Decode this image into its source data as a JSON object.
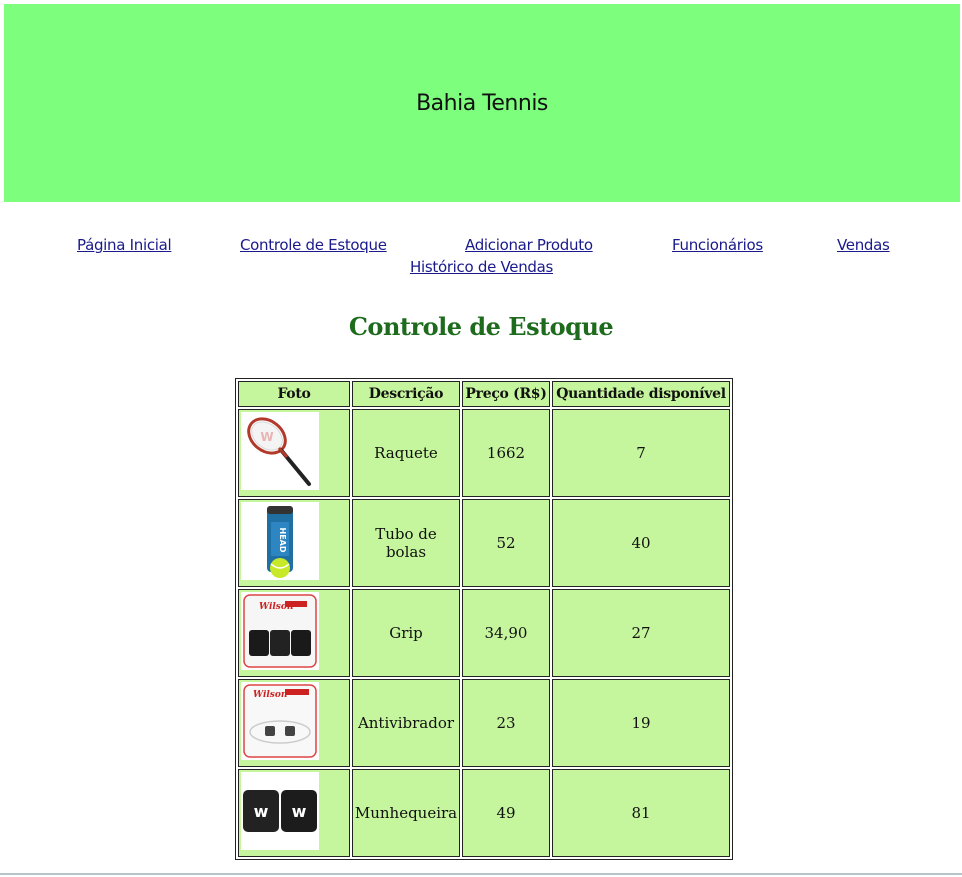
{
  "header": {
    "title": "Bahia Tennis",
    "bg_color": "#7dff7d"
  },
  "nav": {
    "links": [
      {
        "label": "Página Inicial"
      },
      {
        "label": "Controle de Estoque"
      },
      {
        "label": "Adicionar Produto"
      },
      {
        "label": "Funcionários"
      },
      {
        "label": "Vendas"
      },
      {
        "label": "Histórico de Vendas"
      }
    ]
  },
  "main": {
    "heading": "Controle de Estoque",
    "table": {
      "headers": [
        "Foto",
        "Descrição",
        "Preço (R$)",
        "Quantidade disponível"
      ],
      "rows": [
        {
          "image": "racket-photo",
          "descricao": "Raquete",
          "preco": "1662",
          "quantidade": "7"
        },
        {
          "image": "ball-tube-photo",
          "descricao": "Tubo de bolas",
          "preco": "52",
          "quantidade": "40"
        },
        {
          "image": "grip-photo",
          "descricao": "Grip",
          "preco": "34,90",
          "quantidade": "27"
        },
        {
          "image": "dampener-photo",
          "descricao": "Antivibrador",
          "preco": "23",
          "quantidade": "19"
        },
        {
          "image": "wristband-photo",
          "descricao": "Munhequeira",
          "preco": "49",
          "quantidade": "81"
        }
      ]
    }
  },
  "colors": {
    "table_cell": "#c5f59c",
    "heading": "#1e6b1e",
    "link": "#1a1a8c"
  }
}
